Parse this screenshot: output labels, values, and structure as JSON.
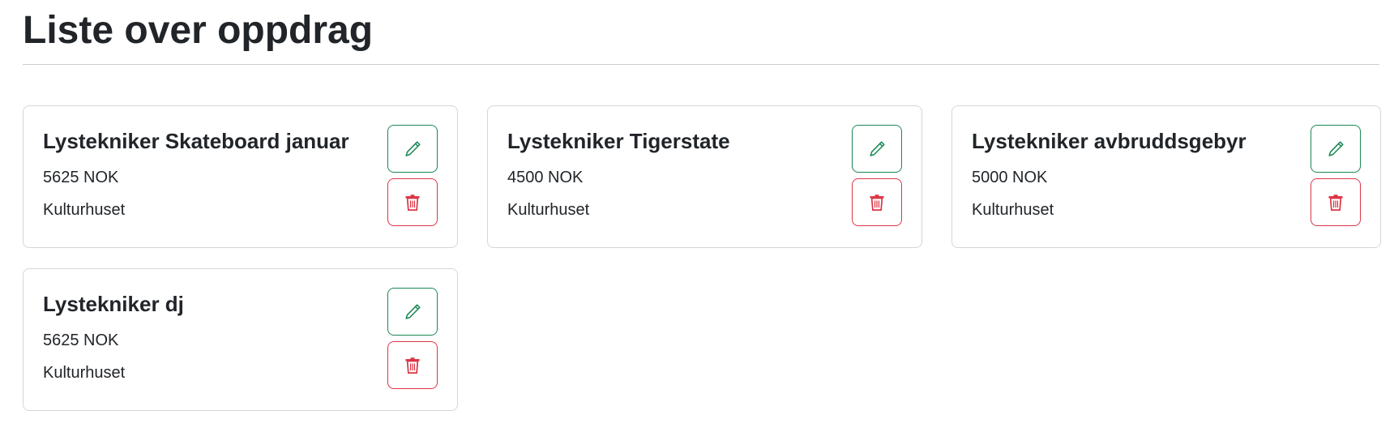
{
  "page": {
    "title": "Liste over oppdrag"
  },
  "colors": {
    "edit": "#198754",
    "delete": "#dc3545"
  },
  "cards": [
    {
      "title": "Lystekniker Skateboard januar",
      "price": "5625 NOK",
      "location": "Kulturhuset",
      "edit_icon": "pencil-icon",
      "delete_icon": "trash-icon"
    },
    {
      "title": "Lystekniker Tigerstate",
      "price": "4500 NOK",
      "location": "Kulturhuset",
      "edit_icon": "pencil-icon",
      "delete_icon": "trash-icon"
    },
    {
      "title": "Lystekniker avbruddsgebyr",
      "price": "5000 NOK",
      "location": "Kulturhuset",
      "edit_icon": "pencil-icon",
      "delete_icon": "trash-icon"
    },
    {
      "title": "Lystekniker dj",
      "price": "5625 NOK",
      "location": "Kulturhuset",
      "edit_icon": "pencil-icon",
      "delete_icon": "trash-icon"
    }
  ]
}
